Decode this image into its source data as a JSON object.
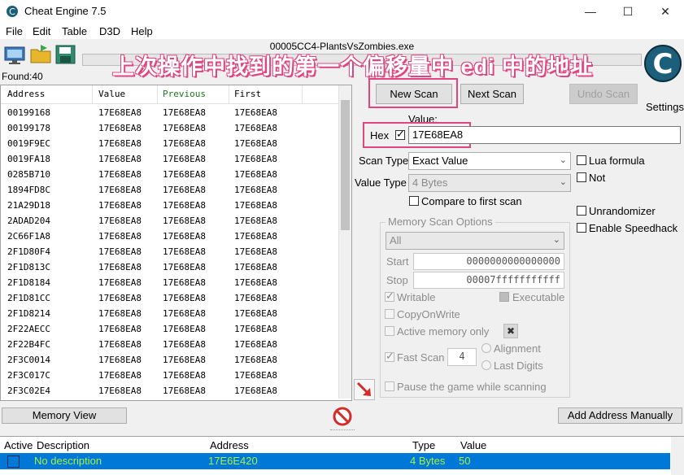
{
  "window": {
    "title": "Cheat Engine 7.5",
    "process": "00005CC4-PlantsVsZombies.exe"
  },
  "menu": [
    "File",
    "Edit",
    "Table",
    "D3D",
    "Help"
  ],
  "found": "Found:40",
  "annotation": "上次操作中找到的第一个偏移量中 edi 中的地址",
  "columns": {
    "address": "Address",
    "value": "Value",
    "previous": "Previous",
    "first": "First"
  },
  "rows": [
    [
      "00199168",
      "17E68EA8",
      "17E68EA8",
      "17E68EA8"
    ],
    [
      "00199178",
      "17E68EA8",
      "17E68EA8",
      "17E68EA8"
    ],
    [
      "0019F9EC",
      "17E68EA8",
      "17E68EA8",
      "17E68EA8"
    ],
    [
      "0019FA18",
      "17E68EA8",
      "17E68EA8",
      "17E68EA8"
    ],
    [
      "0285B710",
      "17E68EA8",
      "17E68EA8",
      "17E68EA8"
    ],
    [
      "1894FD8C",
      "17E68EA8",
      "17E68EA8",
      "17E68EA8"
    ],
    [
      "21A29D18",
      "17E68EA8",
      "17E68EA8",
      "17E68EA8"
    ],
    [
      "2ADAD204",
      "17E68EA8",
      "17E68EA8",
      "17E68EA8"
    ],
    [
      "2C66F1A8",
      "17E68EA8",
      "17E68EA8",
      "17E68EA8"
    ],
    [
      "2F1D80F4",
      "17E68EA8",
      "17E68EA8",
      "17E68EA8"
    ],
    [
      "2F1D813C",
      "17E68EA8",
      "17E68EA8",
      "17E68EA8"
    ],
    [
      "2F1D8184",
      "17E68EA8",
      "17E68EA8",
      "17E68EA8"
    ],
    [
      "2F1D81CC",
      "17E68EA8",
      "17E68EA8",
      "17E68EA8"
    ],
    [
      "2F1D8214",
      "17E68EA8",
      "17E68EA8",
      "17E68EA8"
    ],
    [
      "2F22AECC",
      "17E68EA8",
      "17E68EA8",
      "17E68EA8"
    ],
    [
      "2F22B4FC",
      "17E68EA8",
      "17E68EA8",
      "17E68EA8"
    ],
    [
      "2F3C0014",
      "17E68EA8",
      "17E68EA8",
      "17E68EA8"
    ],
    [
      "2F3C017C",
      "17E68EA8",
      "17E68EA8",
      "17E68EA8"
    ],
    [
      "2F3C02E4",
      "17E68EA8",
      "17E68EA8",
      "17E68EA8"
    ]
  ],
  "buttons": {
    "new_scan": "New Scan",
    "next_scan": "Next Scan",
    "undo_scan": "Undo Scan",
    "settings": "Settings",
    "memory_view": "Memory View",
    "add_address": "Add Address Manually"
  },
  "scan": {
    "value_label": "Value:",
    "hex_label": "Hex",
    "value": "17E68EA8",
    "scan_type_label": "Scan Type",
    "scan_type": "Exact Value",
    "value_type_label": "Value Type",
    "value_type": "4 Bytes",
    "compare_first": "Compare to first scan",
    "lua_formula": "Lua formula",
    "not": "Not",
    "unrandomizer": "Unrandomizer",
    "speedhack": "Enable Speedhack"
  },
  "memory_options": {
    "title": "Memory Scan Options",
    "region": "All",
    "start_label": "Start",
    "start": "0000000000000000",
    "stop_label": "Stop",
    "stop": "00007fffffffffff",
    "writable": "Writable",
    "executable": "Executable",
    "copy_on_write": "CopyOnWrite",
    "active_only": "Active memory only",
    "fast_scan": "Fast Scan",
    "fast_scan_value": "4",
    "alignment": "Alignment",
    "last_digits": "Last Digits",
    "pause": "Pause the game while scanning"
  },
  "address_table": {
    "headers": {
      "active": "Active",
      "description": "Description",
      "address": "Address",
      "type": "Type",
      "value": "Value"
    },
    "row": {
      "description": "No description",
      "address": "17E6E420",
      "type": "4 Bytes",
      "value": "50"
    }
  },
  "colors": {
    "accent": "#e0457f",
    "selection": "#0078d7",
    "selection_text": "#a8f23a",
    "previous_header": "#1a7a1a"
  }
}
